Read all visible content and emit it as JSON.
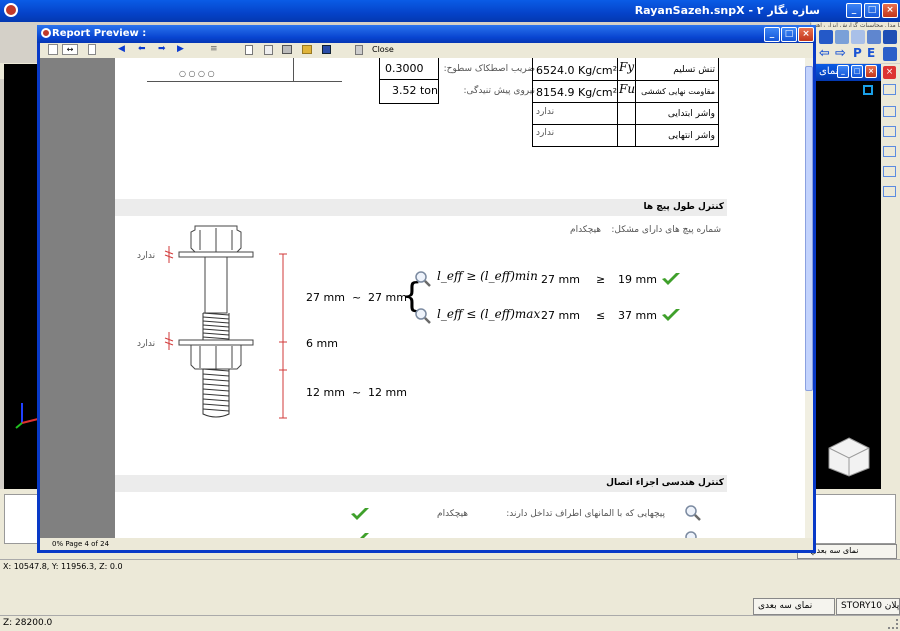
{
  "app": {
    "title": "RayanSazeh.snpX - سازه نگار ۲",
    "menu_text": "پرونده  ویرایش  نما  مدل  محاسبات  گزارش  ابزار  راهنما"
  },
  "report_window": {
    "title": "Report Preview :",
    "toolbar": {
      "close_label": "Close"
    },
    "status": "0%  Page 4 of 24"
  },
  "report": {
    "top_table_left": {
      "friction_value": "0.3000",
      "friction_label": "ضریب اصطکاک سطوح:",
      "pretension_value": "3.52 ton",
      "pretension_label": "نیروی پیش تنیدگی:"
    },
    "top_table_right": {
      "rows": [
        {
          "value": "6524.0 Kg/cm²",
          "symbol": "Fy",
          "label": "تنش تسلیم"
        },
        {
          "value": "8154.9 Kg/cm²",
          "symbol": "Fu",
          "label": "مقاومت نهایی کششی"
        },
        {
          "value": "ندارد",
          "symbol": "",
          "label": "واشر ابتدایی"
        },
        {
          "value": "ندارد",
          "symbol": "",
          "label": "واشر انتهایی"
        }
      ]
    },
    "symbols_row": "○   ○  ○   ○",
    "bolt_length": {
      "title": "کنترل طول پیچ ها",
      "shape_label": "شماره پیچ های دارای مشکل:",
      "shape_value": "هیچکدام",
      "washer_top": "ندارد",
      "washer_bottom": "ندارد",
      "range_left": "27 mm",
      "range_tilde": "~",
      "range_right": "27 mm",
      "cond1_formula": "l_eff ≥ (l_eff)min",
      "cond1_val": "27 mm",
      "cond1_op": "≥",
      "cond1_limit": "19 mm",
      "cond2_formula": "l_eff ≤ (l_eff)max",
      "cond2_val": "27 mm",
      "cond2_op": "≤",
      "cond2_limit": "37 mm",
      "nut_height": "6 mm",
      "thread_left": "12 mm",
      "thread_tilde": "~",
      "thread_right": "12 mm"
    },
    "geometry": {
      "title": "کنترل هندسی اجزاء اتصال",
      "row1_label": "پیچهایی که با المانهای اطراف تداخل دارند:",
      "row1_value": "هیچکدام"
    }
  },
  "bottom": {
    "tab_3d": "نمای سه بعدی",
    "tab_story": "STORY10",
    "tab_plan": "پلان",
    "tab_3d_small": "نمای سه بعدي",
    "coords": "X: 10547.8, Y: 11956.3, Z: 0.0",
    "z_status": "Z: 28200.0"
  },
  "right_panel": {
    "title": "نمای"
  },
  "colors": {
    "titlebar": "#0543c9",
    "check_green": "#3fa02b",
    "dim_red": "#d23a3a"
  }
}
